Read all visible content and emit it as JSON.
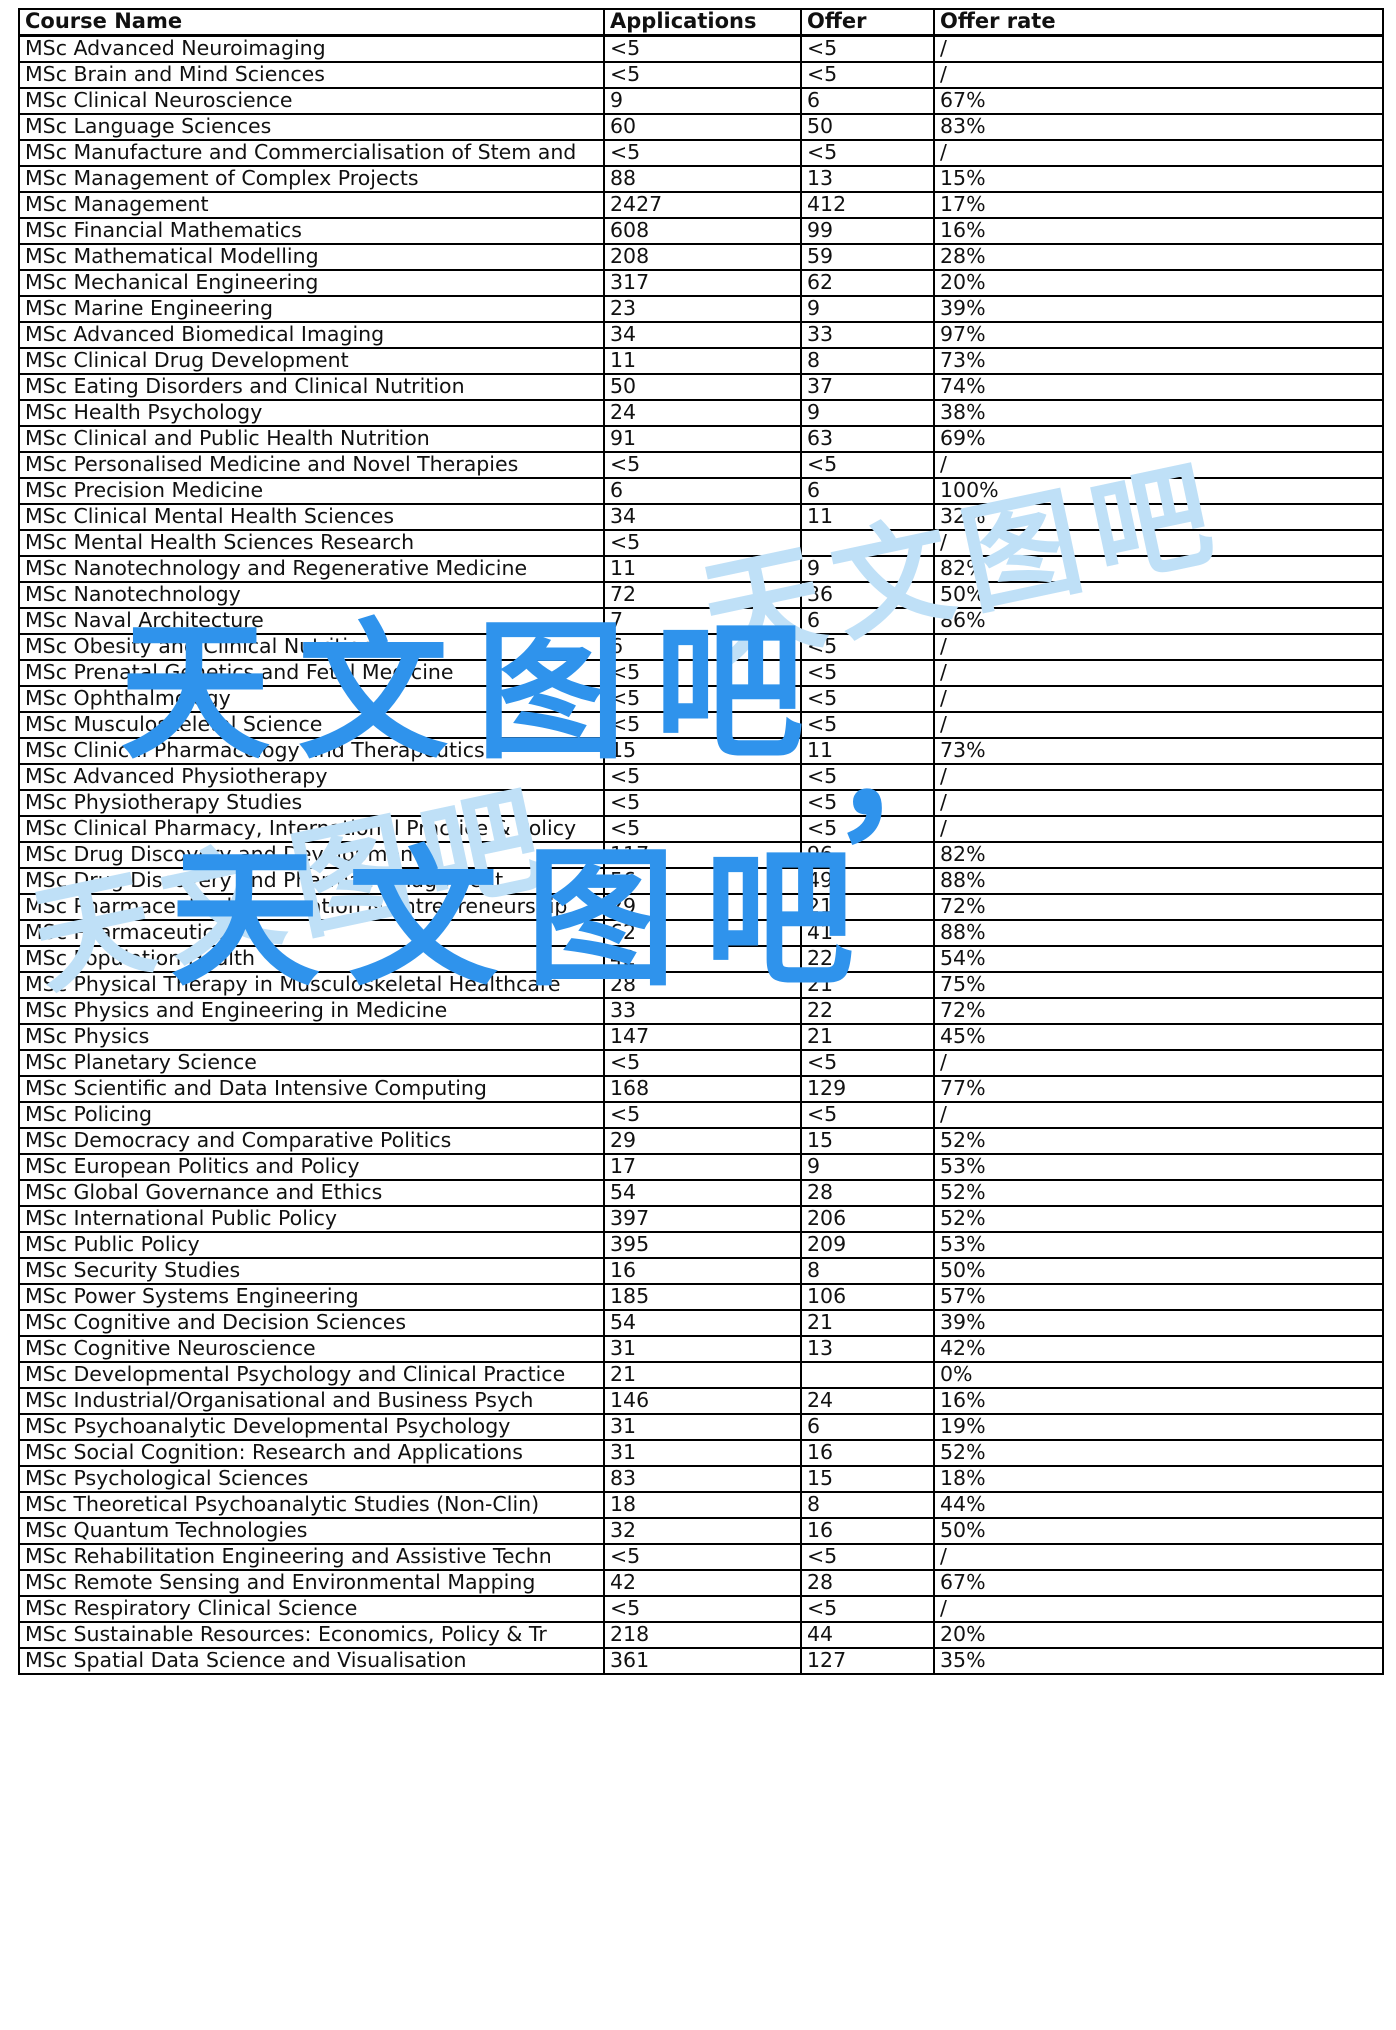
{
  "table": {
    "columns": [
      "Course Name",
      "Applications",
      "Offer",
      "Offer rate"
    ],
    "rows": [
      [
        "MSc Advanced Neuroimaging",
        "<5",
        "<5",
        "/"
      ],
      [
        "MSc Brain and Mind Sciences",
        "<5",
        "<5",
        "/"
      ],
      [
        "MSc Clinical Neuroscience",
        "9",
        "6",
        "67%"
      ],
      [
        "MSc Language Sciences",
        "60",
        "50",
        "83%"
      ],
      [
        "MSc Manufacture and Commercialisation of Stem and",
        "<5",
        "<5",
        "/"
      ],
      [
        "MSc Management of Complex Projects",
        "88",
        "13",
        "15%"
      ],
      [
        "MSc Management",
        "2427",
        "412",
        "17%"
      ],
      [
        "MSc Financial Mathematics",
        "608",
        "99",
        "16%"
      ],
      [
        "MSc Mathematical Modelling",
        "208",
        "59",
        "28%"
      ],
      [
        "MSc Mechanical Engineering",
        "317",
        "62",
        "20%"
      ],
      [
        "MSc Marine Engineering",
        "23",
        "9",
        "39%"
      ],
      [
        "MSc Advanced Biomedical Imaging",
        "34",
        "33",
        "97%"
      ],
      [
        "MSc Clinical Drug Development",
        "11",
        "8",
        "73%"
      ],
      [
        "MSc Eating Disorders and Clinical Nutrition",
        "50",
        "37",
        "74%"
      ],
      [
        "MSc Health Psychology",
        "24",
        "9",
        "38%"
      ],
      [
        "MSc Clinical and Public Health Nutrition",
        "91",
        "63",
        "69%"
      ],
      [
        "MSc Personalised Medicine and Novel Therapies",
        "<5",
        "<5",
        "/"
      ],
      [
        "MSc Precision Medicine",
        "6",
        "6",
        "100%"
      ],
      [
        "MSc Clinical Mental Health Sciences",
        "34",
        "11",
        "32%"
      ],
      [
        "MSc Mental Health Sciences Research",
        "<5",
        "",
        "/"
      ],
      [
        "MSc Nanotechnology and Regenerative Medicine",
        "11",
        "9",
        "82%"
      ],
      [
        "MSc Nanotechnology",
        "72",
        "36",
        "50%"
      ],
      [
        "MSc Naval Architecture",
        "7",
        "6",
        "86%"
      ],
      [
        "MSc Obesity and Clinical Nutrition",
        "6",
        "<5",
        "/"
      ],
      [
        "MSc Prenatal Genetics and Fetal Medicine",
        "<5",
        "<5",
        "/"
      ],
      [
        "MSc Ophthalmology",
        "<5",
        "<5",
        "/"
      ],
      [
        "MSc Musculoskeletal Science",
        "<5",
        "<5",
        "/"
      ],
      [
        "MSc Clinical Pharmacology and Therapeutics",
        "15",
        "11",
        "73%"
      ],
      [
        "MSc Advanced Physiotherapy",
        "<5",
        "<5",
        "/"
      ],
      [
        "MSc Physiotherapy Studies",
        "<5",
        "<5",
        "/"
      ],
      [
        "MSc Clinical Pharmacy, International Practice & Policy",
        "<5",
        "<5",
        "/"
      ],
      [
        "MSc Drug Discovery and Development",
        "117",
        "96",
        "82%"
      ],
      [
        "MSc Drug Discovery and Pharma Management",
        "56",
        "49",
        "88%"
      ],
      [
        "MSc Pharmaceutical Formulation & Entrepreneurship",
        "29",
        "21",
        "72%"
      ],
      [
        "MSc Pharmaceutics",
        "62",
        "41",
        "88%"
      ],
      [
        "MSc Population Health",
        "42",
        "22",
        "54%"
      ],
      [
        "MSc Physical Therapy in Musculoskeletal Healthcare",
        "28",
        "21",
        "75%"
      ],
      [
        "MSc Physics and Engineering in Medicine",
        "33",
        "22",
        "72%"
      ],
      [
        "MSc Physics",
        "147",
        "21",
        "45%"
      ],
      [
        "MSc Planetary Science",
        "<5",
        "<5",
        "/"
      ],
      [
        "MSc Scientific and Data Intensive Computing",
        "168",
        "129",
        "77%"
      ],
      [
        "MSc Policing",
        "<5",
        "<5",
        "/"
      ],
      [
        "MSc Democracy and Comparative Politics",
        "29",
        "15",
        "52%"
      ],
      [
        "MSc European Politics and Policy",
        "17",
        "9",
        "53%"
      ],
      [
        "MSc Global Governance and Ethics",
        "54",
        "28",
        "52%"
      ],
      [
        "MSc International Public Policy",
        "397",
        "206",
        "52%"
      ],
      [
        "MSc Public Policy",
        "395",
        "209",
        "53%"
      ],
      [
        "MSc Security Studies",
        "16",
        "8",
        "50%"
      ],
      [
        "MSc Power Systems Engineering",
        "185",
        "106",
        "57%"
      ],
      [
        "MSc Cognitive and Decision Sciences",
        "54",
        "21",
        "39%"
      ],
      [
        "MSc Cognitive Neuroscience",
        "31",
        "13",
        "42%"
      ],
      [
        "MSc Developmental Psychology and Clinical Practice",
        "21",
        "",
        "0%"
      ],
      [
        "MSc Industrial/Organisational and Business Psych",
        "146",
        "24",
        "16%"
      ],
      [
        "MSc Psychoanalytic Developmental Psychology",
        "31",
        "6",
        "19%"
      ],
      [
        "MSc Social Cognition: Research and Applications",
        "31",
        "16",
        "52%"
      ],
      [
        "MSc Psychological Sciences",
        "83",
        "15",
        "18%"
      ],
      [
        "MSc Theoretical Psychoanalytic Studies (Non-Clin)",
        "18",
        "8",
        "44%"
      ],
      [
        "MSc Quantum Technologies",
        "32",
        "16",
        "50%"
      ],
      [
        "MSc Rehabilitation Engineering and Assistive Techn",
        "<5",
        "<5",
        "/"
      ],
      [
        "MSc Remote Sensing and Environmental Mapping",
        "42",
        "28",
        "67%"
      ],
      [
        "MSc Respiratory Clinical Science",
        "<5",
        "<5",
        "/"
      ],
      [
        "MSc Sustainable Resources: Economics, Policy & Tr",
        "218",
        "44",
        "20%"
      ],
      [
        "MSc Spatial Data Science and Visualisation",
        "361",
        "127",
        "35%"
      ]
    ]
  },
  "watermark": {
    "accent_color": "#2f93ec",
    "faint_color": "#bfe0f7",
    "main_line1": "天文图吧",
    "main_line2": "天文图吧",
    "comma": "，",
    "faint_top": "天文图吧",
    "faint_bottom": "天文图吧"
  }
}
